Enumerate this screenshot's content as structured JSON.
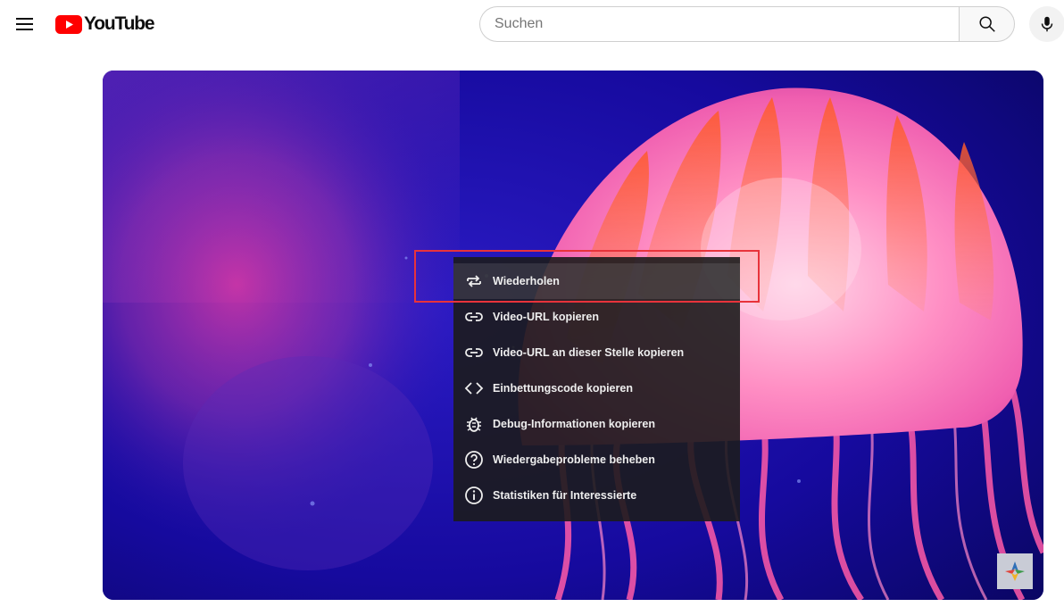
{
  "header": {
    "logo_text": "YouTube",
    "search_placeholder": "Suchen",
    "search_value": ""
  },
  "context_menu": {
    "items": [
      {
        "label": "Wiederholen",
        "icon": "loop-icon"
      },
      {
        "label": "Video-URL kopieren",
        "icon": "link-icon"
      },
      {
        "label": "Video-URL an dieser Stelle kopieren",
        "icon": "link-icon"
      },
      {
        "label": "Einbettungscode kopieren",
        "icon": "embed-code-icon"
      },
      {
        "label": "Debug-Informationen kopieren",
        "icon": "debug-bug-icon"
      },
      {
        "label": "Wiedergabeprobleme beheben",
        "icon": "help-icon"
      },
      {
        "label": "Statistiken für Interessierte",
        "icon": "info-icon"
      }
    ],
    "highlighted_item": "Wiederholen"
  },
  "colors": {
    "brand_red": "#ff0000",
    "highlight_border": "#e8333b",
    "menu_bg": "#1c1c1c",
    "video_bg": "#1a0fa0"
  }
}
